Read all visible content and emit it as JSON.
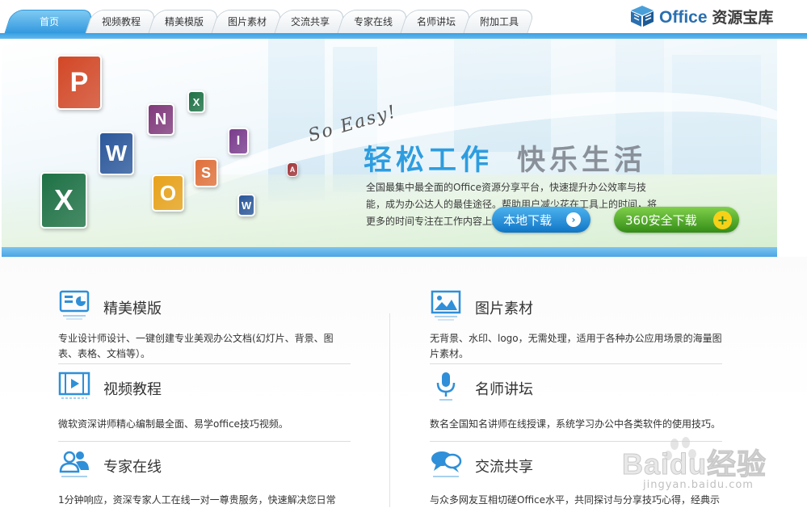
{
  "nav": {
    "tabs": [
      {
        "label": "首页",
        "active": true
      },
      {
        "label": "视频教程",
        "active": false
      },
      {
        "label": "精美模版",
        "active": false
      },
      {
        "label": "图片素材",
        "active": false
      },
      {
        "label": "交流共享",
        "active": false
      },
      {
        "label": "专家在线",
        "active": false
      },
      {
        "label": "名师讲坛",
        "active": false
      },
      {
        "label": "附加工具",
        "active": false
      }
    ],
    "logo_main": "Office",
    "logo_sub": "资源宝库"
  },
  "banner": {
    "tagline": "So Easy!",
    "slogan_left": "轻松工作",
    "slogan_right": "快乐生活",
    "description": "全国最集中最全面的Office资源分享平台，快速提升办公效率与技能，成为办公达人的最佳途径。帮助用户减少花在工具上的时间，将更多的时间专注在工作内容上。",
    "btn_local": "本地下载",
    "btn_360": "360安全下载",
    "app_icons": [
      {
        "letter": "P",
        "color": "#d24726"
      },
      {
        "letter": "N",
        "color": "#80397b"
      },
      {
        "letter": "X",
        "color": "#1e7145"
      },
      {
        "letter": "W",
        "color": "#2b579a"
      },
      {
        "letter": "O",
        "color": "#e8a21b"
      },
      {
        "letter": "S",
        "color": "#e0703a"
      },
      {
        "letter": "X",
        "color": "#1e7145"
      },
      {
        "letter": "I",
        "color": "#7a3c8c"
      },
      {
        "letter": "W",
        "color": "#2b579a"
      },
      {
        "letter": "A",
        "color": "#a4373a"
      }
    ]
  },
  "features": [
    {
      "title": "精美模版",
      "desc": "专业设计师设计、一键创建专业美观办公文档(幻灯片、背景、图表、表格、文档等）。",
      "icon": "slide-template-icon"
    },
    {
      "title": "图片素材",
      "desc": "无背景、水印、logo，无需处理，适用于各种办公应用场景的海量图片素材。",
      "icon": "picture-icon"
    },
    {
      "title": "视频教程",
      "desc": "微软资深讲师精心编制最全面、易学office技巧视频。",
      "icon": "video-film-icon"
    },
    {
      "title": "名师讲坛",
      "desc": "数名全国知名讲师在线授课，系统学习办公中各类软件的使用技巧。",
      "icon": "microphone-icon"
    },
    {
      "title": "专家在线",
      "desc": "1分钟响应，资深专家人工在线一对一尊贵服务，快速解决您日常",
      "icon": "experts-icon"
    },
    {
      "title": "交流共享",
      "desc": "与众多网友互相切磋Office水平，共同探讨与分享技巧心得，经典示",
      "icon": "chat-bubbles-icon"
    }
  ],
  "watermark": {
    "big": "Baidu经验",
    "small": "jingyan.baidu.com"
  }
}
